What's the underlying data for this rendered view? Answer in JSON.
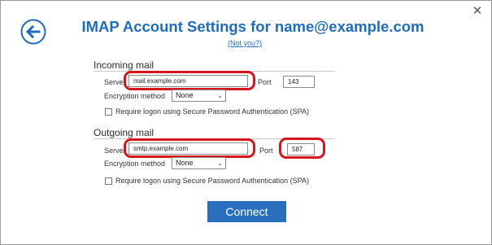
{
  "window": {
    "close_glyph": "✕"
  },
  "header": {
    "title": "IMAP Account Settings for name@example.com",
    "not_you": "(Not you?)",
    "back_icon": "back-arrow-icon"
  },
  "incoming": {
    "heading": "Incoming mail",
    "server_label": "Server",
    "server_value": "mail.example.com",
    "port_label": "Port",
    "port_value": "143",
    "encryption_label": "Encryption method",
    "encryption_value": "None",
    "spa_label": "Require logon using Secure Password Authentication (SPA)",
    "spa_checked": false
  },
  "outgoing": {
    "heading": "Outgoing mail",
    "server_label": "Server",
    "server_value": "smtp.example.com",
    "port_label": "Port",
    "port_value": "587",
    "encryption_label": "Encryption method",
    "encryption_value": "None",
    "spa_label": "Require logon using Secure Password Authentication (SPA)",
    "spa_checked": false
  },
  "actions": {
    "connect_label": "Connect"
  },
  "colors": {
    "accent": "#1e6cc1",
    "button": "#2a6fbe",
    "highlight": "#d8141d"
  }
}
